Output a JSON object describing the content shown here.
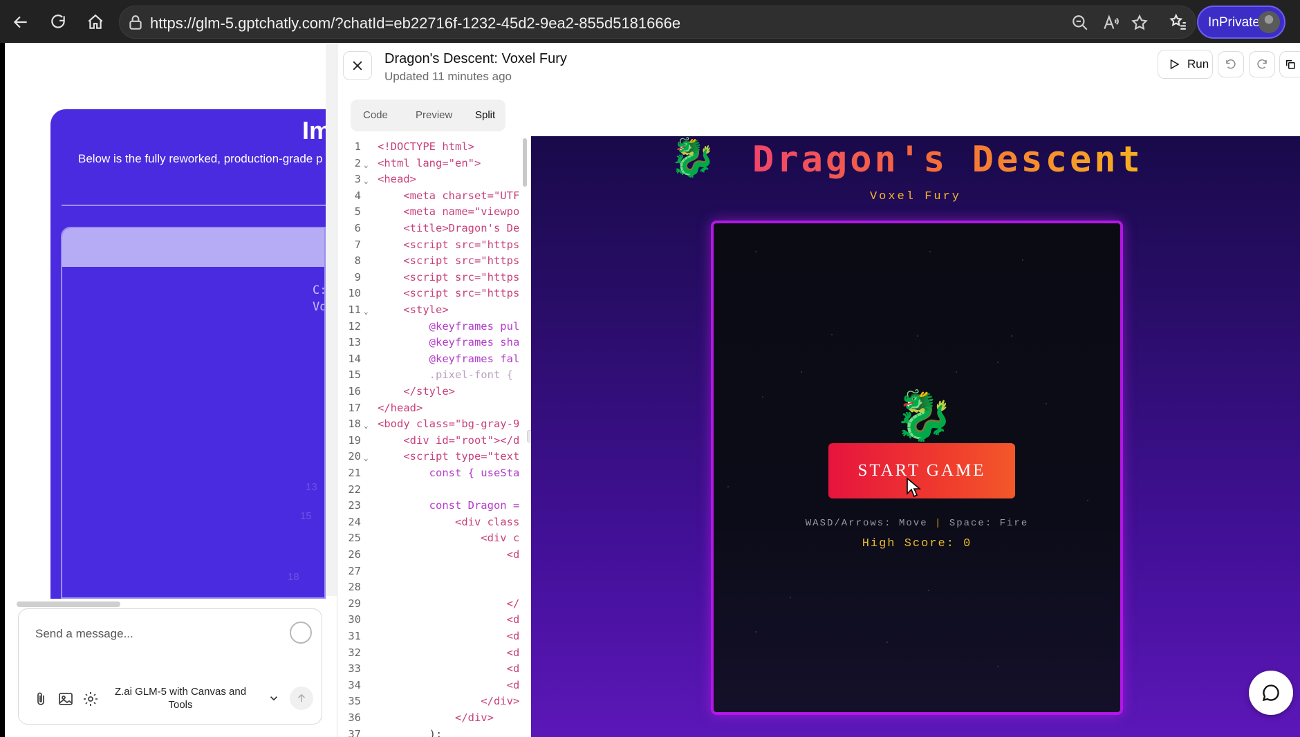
{
  "browser": {
    "url": "https://glm-5.gptchatly.com/?chatId=eb22716f-1232-45d2-9ea2-855d5181666e",
    "inprivate_label": "InPrivate",
    "icons": [
      "back-icon",
      "refresh-icon",
      "home-icon",
      "lock-icon",
      "zoom-out-icon",
      "read-aloud-icon",
      "favorite-icon",
      "favorites-list-icon"
    ]
  },
  "chat": {
    "card_heading": "Im",
    "card_text": "Below is the fully reworked, production-grade p",
    "inner_lines": [
      "C:",
      "Vo"
    ],
    "faint_numbers": [
      "13",
      "15",
      "18"
    ],
    "message_placeholder": "Send a message...",
    "model_name": "Z.ai GLM-5 with Canvas and Tools"
  },
  "canvas": {
    "title": "Dragon's Descent: Voxel Fury",
    "subtitle": "Updated 11 minutes ago",
    "run_label": "Run",
    "tabs": [
      "Code",
      "Preview",
      "Split"
    ],
    "active_tab": "Split"
  },
  "code_lines": [
    {
      "n": "1",
      "t": "<!DOCTYPE html>"
    },
    {
      "n": "2",
      "t": "<html lang=\"en\">",
      "fold": true
    },
    {
      "n": "3",
      "t": "<head>",
      "fold": true
    },
    {
      "n": "4",
      "t": "    <meta charset=\"UTF"
    },
    {
      "n": "5",
      "t": "    <meta name=\"viewpo"
    },
    {
      "n": "6",
      "t": "    <title>Dragon's De"
    },
    {
      "n": "7",
      "t": "    <script src=\"https"
    },
    {
      "n": "8",
      "t": "    <script src=\"https"
    },
    {
      "n": "9",
      "t": "    <script src=\"https"
    },
    {
      "n": "10",
      "t": "    <script src=\"https"
    },
    {
      "n": "11",
      "t": "    <style>",
      "fold": true
    },
    {
      "n": "12",
      "t": "        @keyframes pul"
    },
    {
      "n": "13",
      "t": "        @keyframes sha"
    },
    {
      "n": "14",
      "t": "        @keyframes fal"
    },
    {
      "n": "15",
      "t": "        .pixel-font { "
    },
    {
      "n": "16",
      "t": "    </style>"
    },
    {
      "n": "17",
      "t": "</head>"
    },
    {
      "n": "18",
      "t": "<body class=\"bg-gray-9",
      "fold": true
    },
    {
      "n": "19",
      "t": "    <div id=\"root\"></d"
    },
    {
      "n": "20",
      "t": "    <script type=\"text",
      "fold": true
    },
    {
      "n": "21",
      "t": "        const { useSta"
    },
    {
      "n": "22",
      "t": ""
    },
    {
      "n": "23",
      "t": "        const Dragon ="
    },
    {
      "n": "24",
      "t": "            <div class"
    },
    {
      "n": "25",
      "t": "                <div c"
    },
    {
      "n": "26",
      "t": "                    <d"
    },
    {
      "n": "27",
      "t": ""
    },
    {
      "n": "28",
      "t": ""
    },
    {
      "n": "29",
      "t": "                    </"
    },
    {
      "n": "30",
      "t": "                    <d"
    },
    {
      "n": "31",
      "t": "                    <d"
    },
    {
      "n": "32",
      "t": "                    <d"
    },
    {
      "n": "33",
      "t": "                    <d"
    },
    {
      "n": "34",
      "t": "                    <d"
    },
    {
      "n": "35",
      "t": "                </div>"
    },
    {
      "n": "36",
      "t": "            </div>"
    },
    {
      "n": "37",
      "t": "        );"
    }
  ],
  "game": {
    "title": "Dragon's Descent",
    "subtitle": "Voxel Fury",
    "start_label": "START GAME",
    "controls_move": "WASD/Arrows: Move",
    "controls_sep": "|",
    "controls_fire": "Space: Fire",
    "high_score": "High Score: 0",
    "dragon_glyph": "🐉",
    "colors": {
      "title_start": "#f0456a",
      "title_end": "#f7b11f",
      "frame": "#b516e6",
      "button": "#e6143e"
    }
  }
}
